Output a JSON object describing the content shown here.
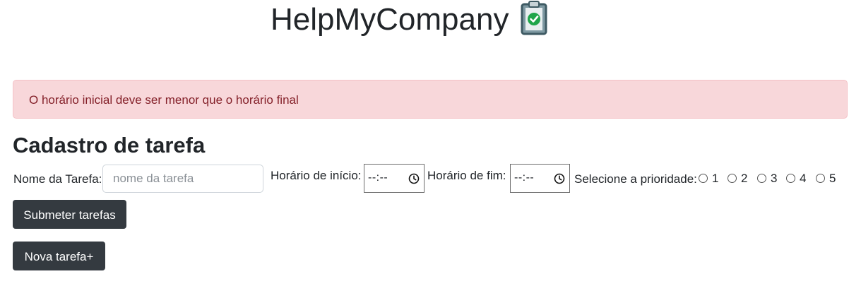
{
  "header": {
    "title": "HelpMyCompany",
    "icon": "clipboard-check-icon"
  },
  "alert": {
    "message": "O horário inicial deve ser menor que o horário final",
    "color": "#842029",
    "background": "#f8d7da"
  },
  "form": {
    "title": "Cadastro de tarefa",
    "task_name_label": "Nome da Tarefa:",
    "task_name_placeholder": "nome da tarefa",
    "task_name_value": "",
    "start_label": "Horário de início:",
    "start_value": "--:--",
    "end_label": "Horário de fim:",
    "end_value": "--:--",
    "priority_label": "Selecione a prioridade:",
    "priority_options": [
      "1",
      "2",
      "3",
      "4",
      "5"
    ]
  },
  "buttons": {
    "submit": "Submeter tarefas",
    "new_task": "Nova tarefa+",
    "color": "#343a40"
  }
}
